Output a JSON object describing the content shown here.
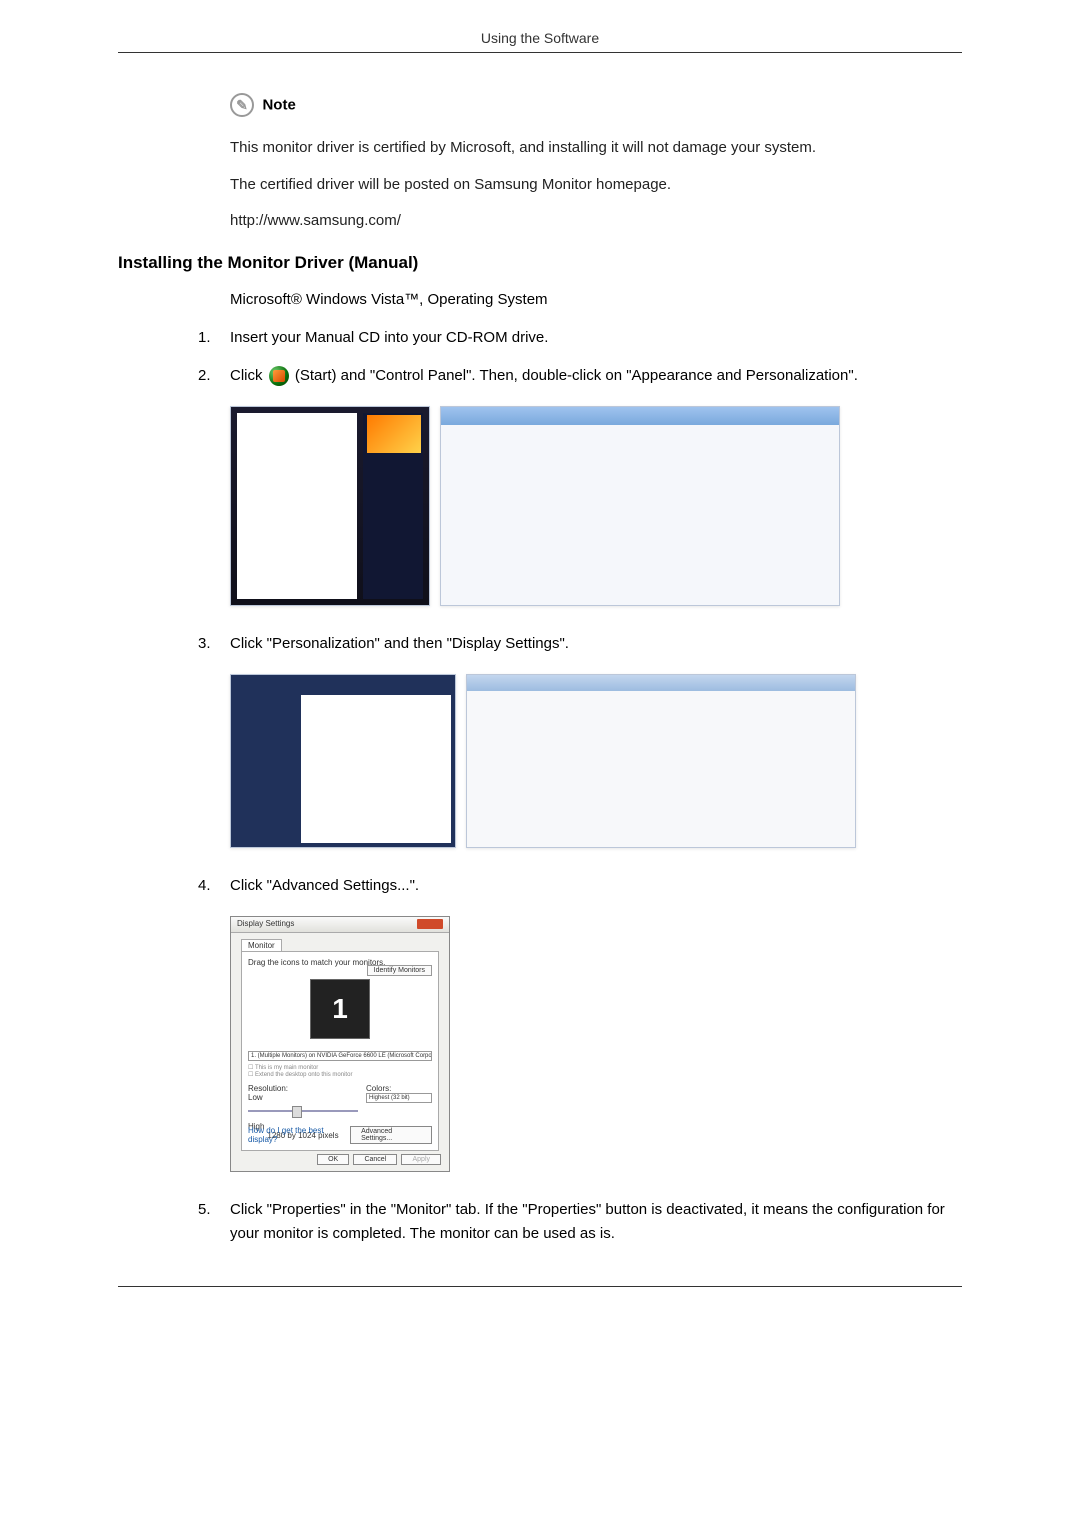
{
  "header": "Using the Software",
  "note": {
    "label": "Note",
    "line1": "This monitor driver is certified by Microsoft, and installing it will not damage your system.",
    "line2": "The certified driver will be posted on Samsung Monitor homepage.",
    "url": "http://www.samsung.com/"
  },
  "section": {
    "title": "Installing the Monitor Driver (Manual)",
    "os": "Microsoft® Windows Vista™, Operating System"
  },
  "steps": {
    "s1": {
      "num": "1.",
      "text": "Insert your Manual CD into your CD-ROM drive."
    },
    "s2": {
      "num": "2.",
      "prefix": "Click ",
      "suffix": "(Start) and \"Control Panel\". Then, double-click on \"Appearance and Personalization\"."
    },
    "s3": {
      "num": "3.",
      "text": "Click \"Personalization\" and then \"Display Settings\"."
    },
    "s4": {
      "num": "4.",
      "text": "Click \"Advanced Settings...\"."
    },
    "s5": {
      "num": "5.",
      "text": "Click \"Properties\" in the \"Monitor\" tab. If the \"Properties\" button is deactivated, it means the configuration for your monitor is completed. The monitor can be used as is."
    }
  },
  "dialog": {
    "title": "Display Settings",
    "tab": "Monitor",
    "drag": "Drag the icons to match your monitors.",
    "identify": "Identify Monitors",
    "monitor_num": "1",
    "adapter": "1. (Multiple Monitors) on NVIDIA GeForce 6600 LE (Microsoft Corporation - ...",
    "chk1": "This is my main monitor",
    "chk2": "Extend the desktop onto this monitor",
    "res_label": "Resolution:",
    "low": "Low",
    "high": "High",
    "res_val": "1280 by 1024 pixels",
    "colors_label": "Colors:",
    "colors_val": "Highest (32 bit)",
    "help": "How do I get the best display?",
    "adv": "Advanced Settings...",
    "ok": "OK",
    "cancel": "Cancel",
    "apply": "Apply"
  }
}
